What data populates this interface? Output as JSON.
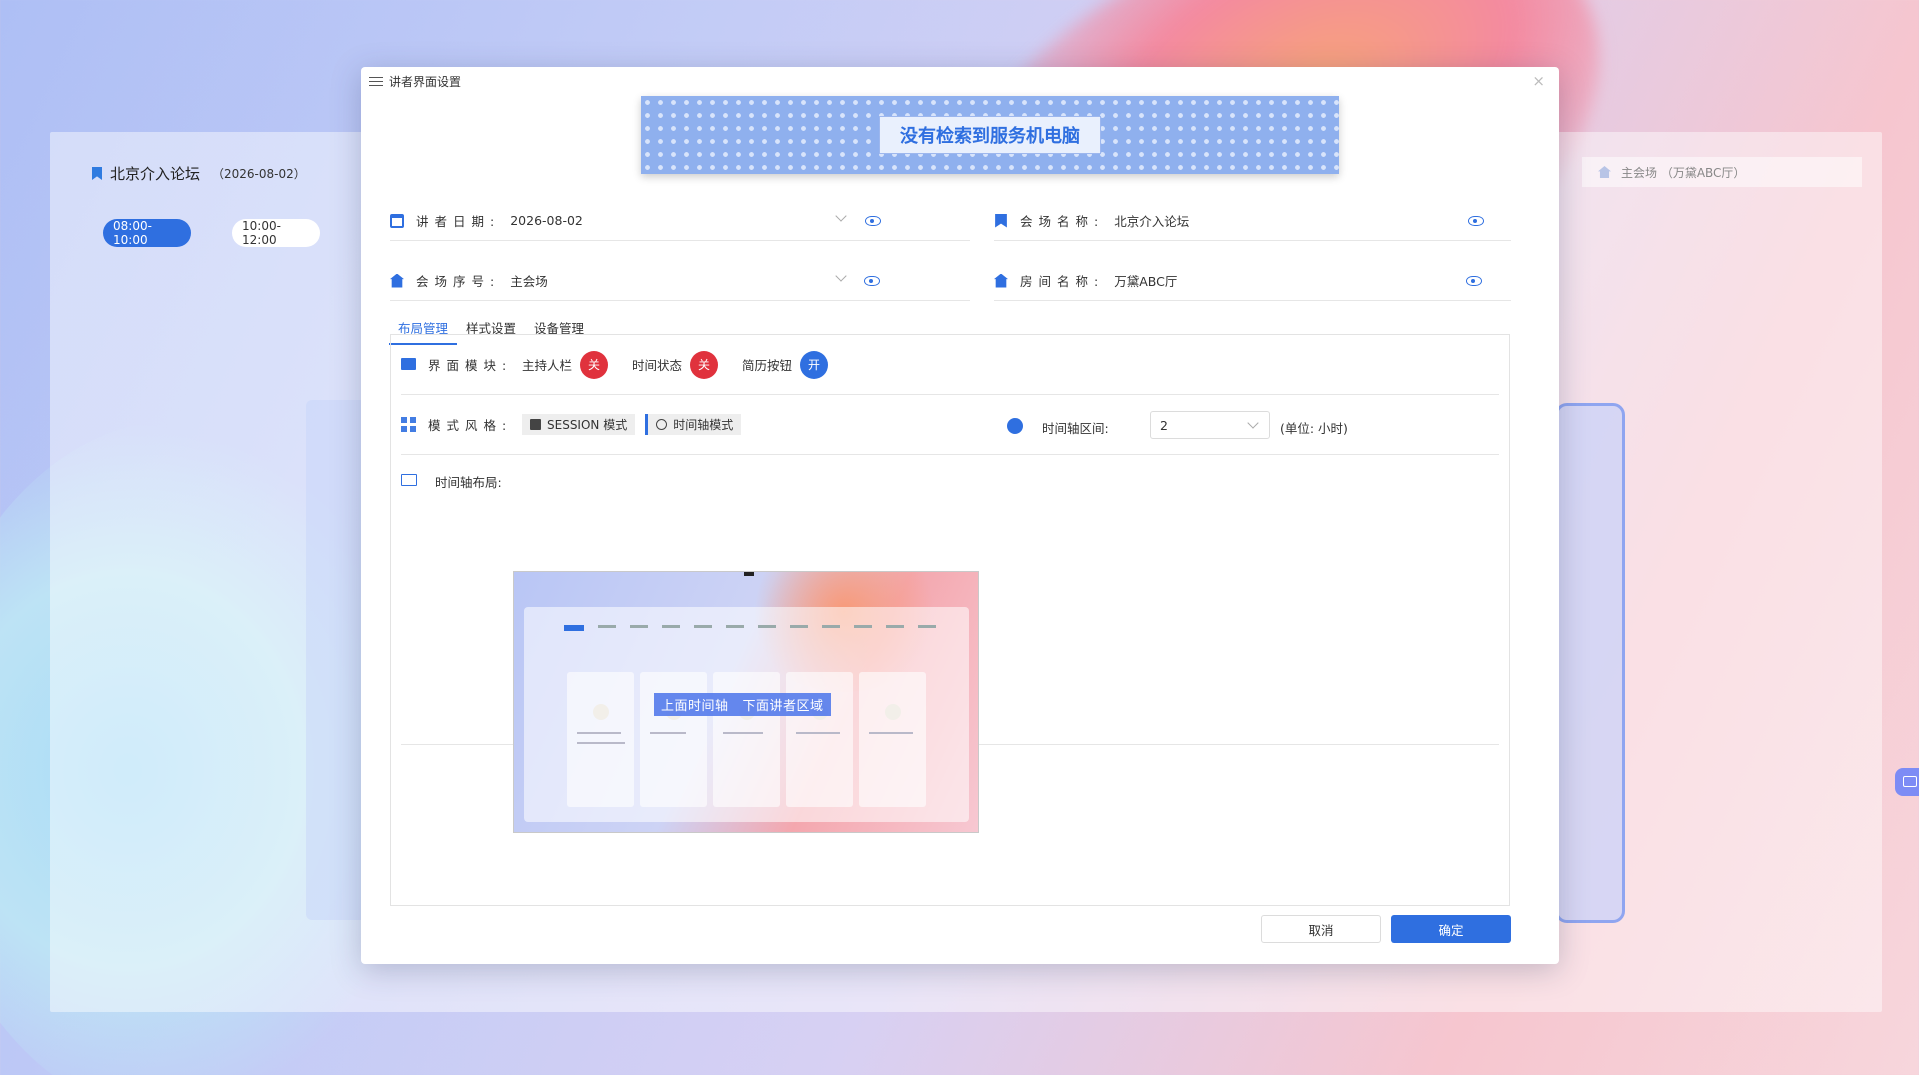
{
  "background": {
    "forum_title": "北京介入论坛",
    "forum_date": "（2026-08-02）",
    "time_slots": [
      "08:00-10:00",
      "10:00-12:00"
    ],
    "venue_info": "主会场 （万黛ABC厅）"
  },
  "dialog": {
    "title": "讲者界面设置",
    "close": "×",
    "banner_message": "没有检索到服务机电脑",
    "fields": {
      "speaker_date": {
        "label": "讲者日期:",
        "value": "2026-08-02"
      },
      "venue_name": {
        "label": "会场名称:",
        "value": "北京介入论坛"
      },
      "venue_number": {
        "label": "会场序号:",
        "value": "主会场"
      },
      "room_name": {
        "label": "房间名称:",
        "value": "万黛ABC厅"
      }
    },
    "tabs": [
      "布局管理",
      "样式设置",
      "设备管理"
    ],
    "modules": {
      "label": "界面模块:",
      "items": [
        {
          "name": "主持人栏",
          "state": "关"
        },
        {
          "name": "时间状态",
          "state": "关"
        },
        {
          "name": "简历按钮",
          "state": "开"
        }
      ]
    },
    "style": {
      "label": "模式风格:",
      "options": [
        "SESSION 模式",
        "时间轴模式"
      ],
      "interval_label": "时间轴区间:",
      "interval_value": "2",
      "interval_unit": "(单位: 小时)"
    },
    "layout": {
      "label": "时间轴布局:",
      "preview_caption_a": "上面时间轴",
      "preview_caption_b": "下面讲者区域"
    },
    "buttons": {
      "cancel": "取消",
      "ok": "确定"
    }
  },
  "colors": {
    "accent": "#2f6fe0",
    "off": "#e0323d"
  }
}
